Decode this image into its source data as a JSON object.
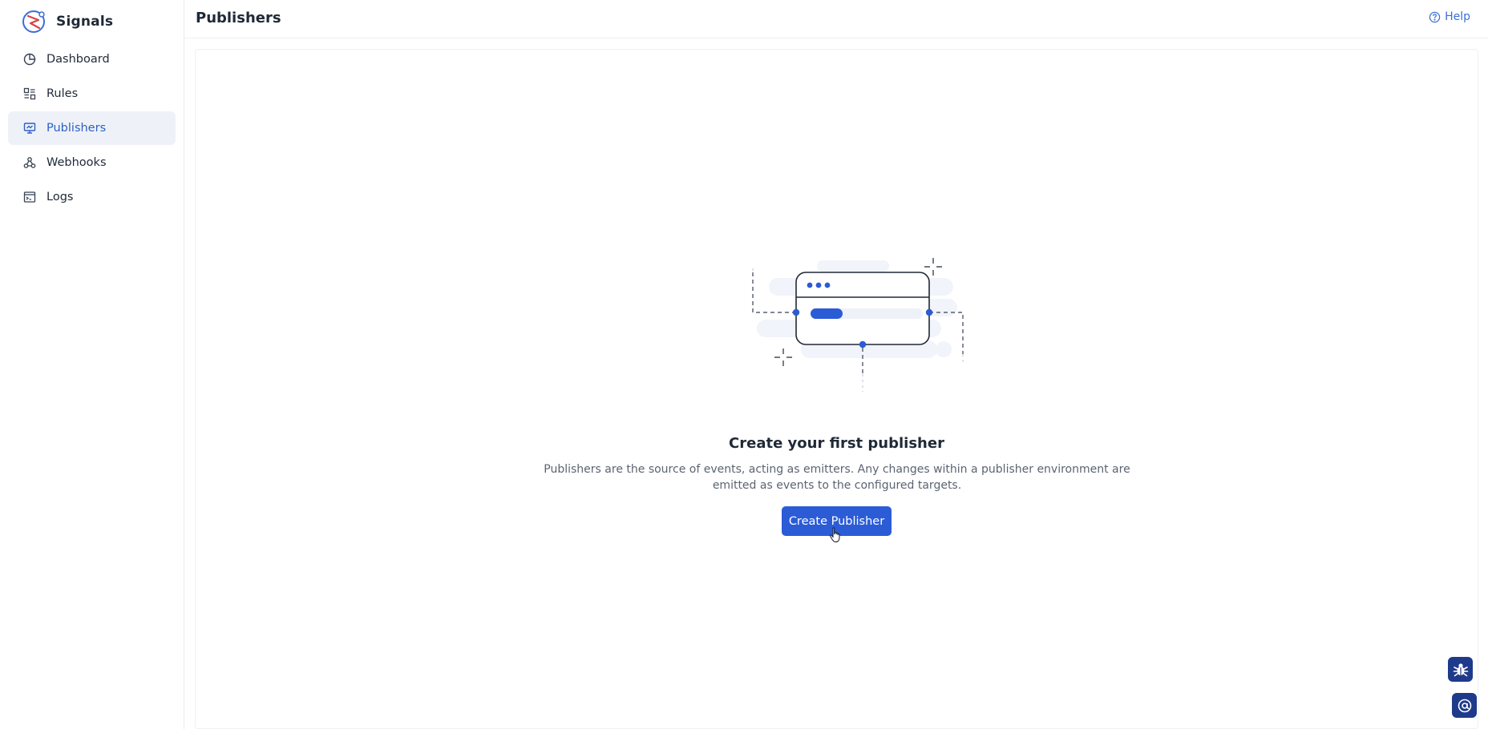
{
  "app": {
    "name": "Signals",
    "logo_icon": "signals-logo-icon"
  },
  "sidebar": {
    "items": [
      {
        "label": "Dashboard",
        "icon": "clock-pie-icon",
        "active": false
      },
      {
        "label": "Rules",
        "icon": "rules-icon",
        "active": false
      },
      {
        "label": "Publishers",
        "icon": "monitor-icon",
        "active": true
      },
      {
        "label": "Webhooks",
        "icon": "webhook-icon",
        "active": false
      },
      {
        "label": "Logs",
        "icon": "terminal-log-icon",
        "active": false
      }
    ]
  },
  "header": {
    "title": "Publishers",
    "help_label": "Help",
    "help_icon": "question-circle-icon"
  },
  "empty_state": {
    "illustration_icon": "publisher-card-illustration",
    "title": "Create your first publisher",
    "description": "Publishers are the source of events, acting as emitters. Any changes within a publisher environment are emitted as events to the configured targets.",
    "button_label": "Create Publisher"
  },
  "floating": {
    "bug_icon": "bug-icon",
    "support_icon": "at-sign-icon"
  },
  "colors": {
    "accent": "#2b5cd6",
    "active_nav_bg": "#eef2f8",
    "active_nav_text": "#2d5fc4",
    "fab_bg": "#1e3a8a"
  }
}
